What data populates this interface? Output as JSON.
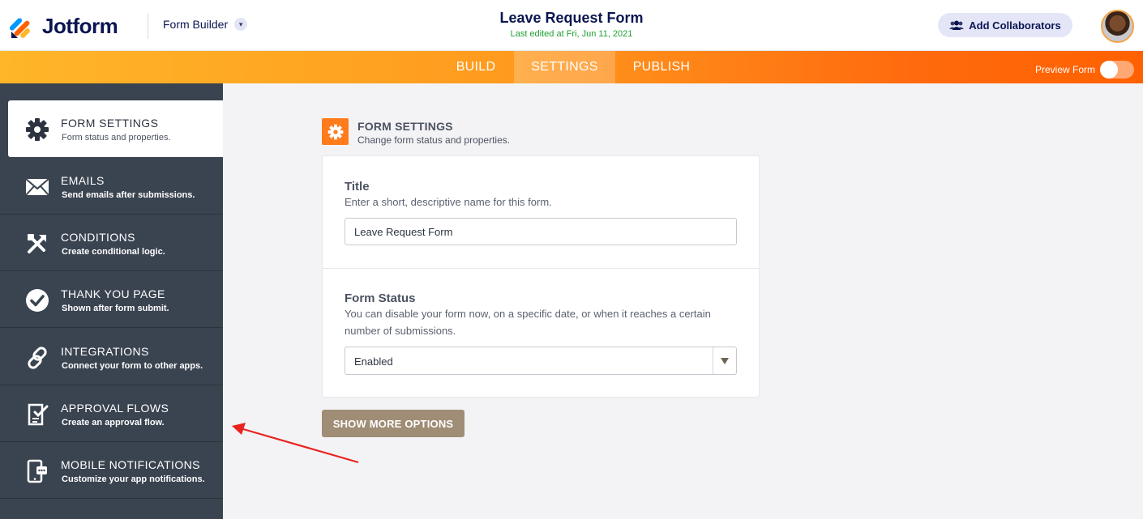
{
  "header": {
    "logo_text": "Jotform",
    "builder_label": "Form Builder",
    "form_title": "Leave Request Form",
    "last_edited": "Last edited at Fri, Jun 11, 2021",
    "collab_label": "Add Collaborators"
  },
  "nav": {
    "tabs": [
      {
        "label": "BUILD"
      },
      {
        "label": "SETTINGS",
        "active": true
      },
      {
        "label": "PUBLISH"
      }
    ],
    "preview_label": "Preview Form",
    "preview_on": false
  },
  "sidebar": {
    "items": [
      {
        "title": "FORM SETTINGS",
        "desc": "Form status and properties.",
        "icon": "gear-icon",
        "active": true
      },
      {
        "title": "EMAILS",
        "desc": "Send emails after submissions.",
        "icon": "envelope-icon"
      },
      {
        "title": "CONDITIONS",
        "desc": "Create conditional logic.",
        "icon": "conditions-icon"
      },
      {
        "title": "THANK YOU PAGE",
        "desc": "Shown after form submit.",
        "icon": "check-circle-icon"
      },
      {
        "title": "INTEGRATIONS",
        "desc": "Connect your form to other apps.",
        "icon": "link-icon"
      },
      {
        "title": "APPROVAL FLOWS",
        "desc": "Create an approval flow.",
        "icon": "approval-icon"
      },
      {
        "title": "MOBILE NOTIFICATIONS",
        "desc": "Customize your app notifications.",
        "icon": "mobile-notification-icon"
      }
    ]
  },
  "main": {
    "section_title": "FORM SETTINGS",
    "section_sub": "Change form status and properties.",
    "title_field": {
      "label": "Title",
      "help": "Enter a short, descriptive name for this form.",
      "value": "Leave Request Form"
    },
    "status_field": {
      "label": "Form Status",
      "help": "You can disable your form now, on a specific date, or when it reaches a certain number of submissions.",
      "value": "Enabled"
    },
    "more_button": "SHOW MORE OPTIONS"
  },
  "colors": {
    "accent_orange": "#ff7b1c",
    "sidebar_bg": "#3a4350",
    "brand_navy": "#0a1551",
    "edited_green": "#1ea032",
    "more_button_bg": "#a08d75",
    "annotation_red": "#e8231f"
  }
}
